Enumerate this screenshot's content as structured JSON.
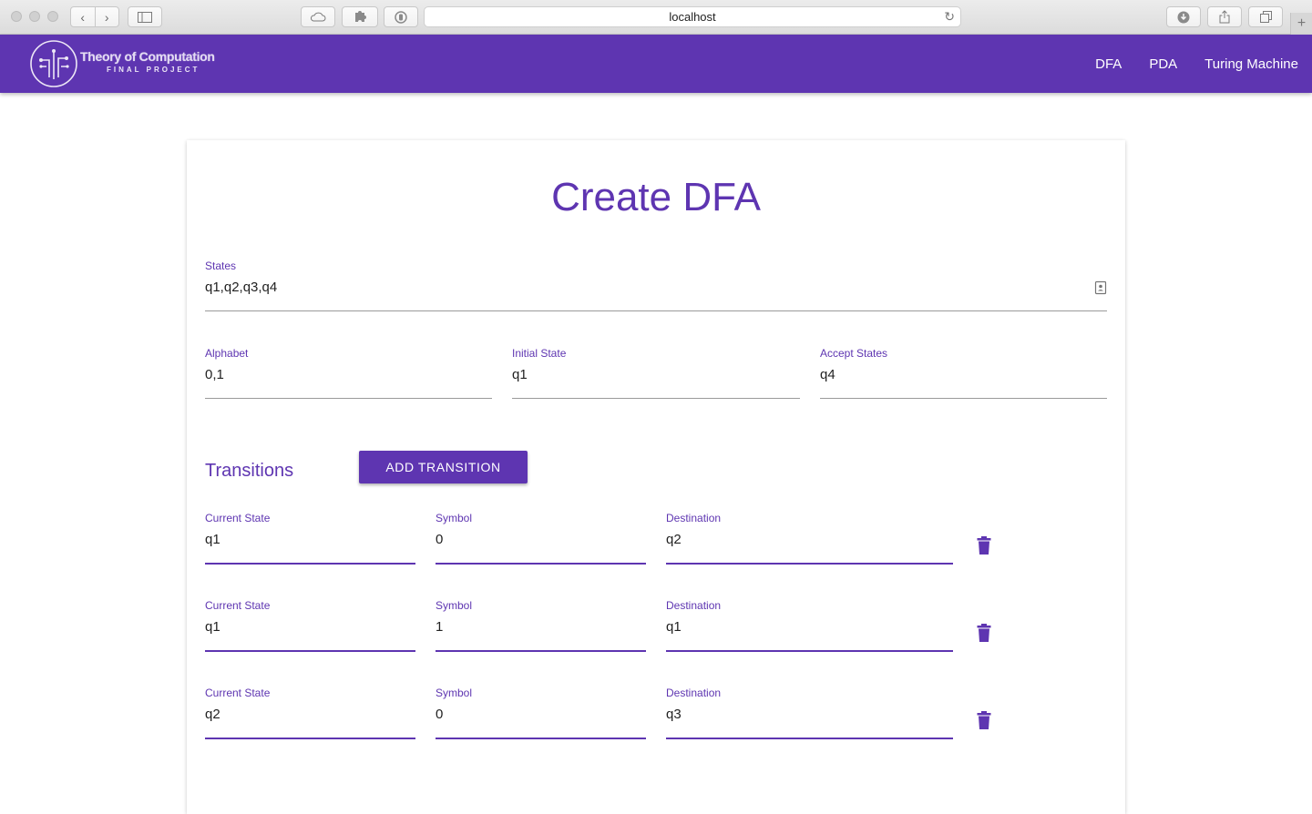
{
  "browser": {
    "url": "localhost"
  },
  "brand": {
    "title": "Theory of Computation",
    "subtitle": "FINAL PROJECT"
  },
  "nav": {
    "links": [
      "DFA",
      "PDA",
      "Turing Machine"
    ]
  },
  "form": {
    "title": "Create DFA",
    "states": {
      "label": "States",
      "value": "q1,q2,q3,q4"
    },
    "alphabet": {
      "label": "Alphabet",
      "value": "0,1"
    },
    "initial_state": {
      "label": "Initial State",
      "value": "q1"
    },
    "accept_states": {
      "label": "Accept States",
      "value": "q4"
    }
  },
  "transitions": {
    "title": "Transitions",
    "add_button": "ADD TRANSITION",
    "labels": {
      "current": "Current State",
      "symbol": "Symbol",
      "destination": "Destination"
    },
    "rows": [
      {
        "current": "q1",
        "symbol": "0",
        "destination": "q2"
      },
      {
        "current": "q1",
        "symbol": "1",
        "destination": "q1"
      },
      {
        "current": "q2",
        "symbol": "0",
        "destination": "q3"
      }
    ]
  },
  "colors": {
    "primary": "#5e35b1"
  },
  "icons": {
    "delete": "trash-icon",
    "states_field": "contact-card-icon"
  }
}
